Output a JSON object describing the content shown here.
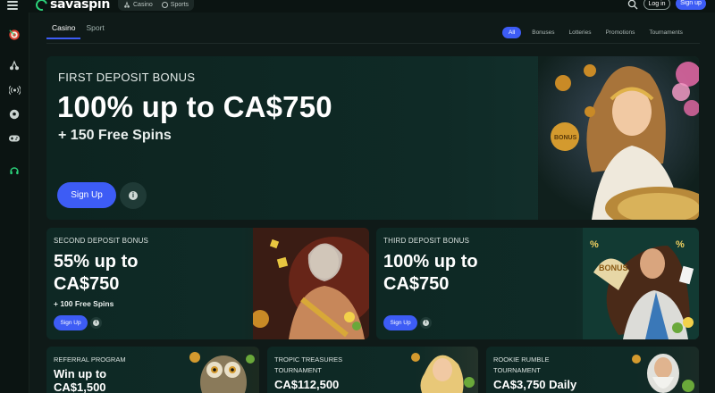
{
  "header": {
    "logo_text": "savaspin",
    "switch": [
      {
        "label": "Casino",
        "icon": "cherries-icon"
      },
      {
        "label": "Sports",
        "icon": "soccer-ball-icon"
      }
    ],
    "login_label": "Log in",
    "signup_label": "Sign up"
  },
  "sidebar": {
    "items": [
      {
        "icon": "dartboard-icon"
      },
      {
        "icon": "cherries-icon"
      },
      {
        "icon": "live-broadcast-icon"
      },
      {
        "icon": "soccer-ball-icon"
      },
      {
        "icon": "gamepad-icon"
      },
      {
        "icon": "headset-icon"
      }
    ]
  },
  "tabs": [
    {
      "label": "Casino",
      "active": true
    },
    {
      "label": "Sport",
      "active": false
    }
  ],
  "filters": [
    {
      "label": "All",
      "active": true
    },
    {
      "label": "Bonuses",
      "active": false
    },
    {
      "label": "Lotteries",
      "active": false
    },
    {
      "label": "Promotions",
      "active": false
    },
    {
      "label": "Tournaments",
      "active": false
    }
  ],
  "hero": {
    "kicker": "FIRST DEPOSIT BONUS",
    "title": "100% up to CA$750",
    "subtitle": "+ 150 Free Spins",
    "signup_label": "Sign Up",
    "art_text": "BONUS"
  },
  "cards": [
    {
      "kicker": "SECOND DEPOSIT BONUS",
      "title": "55% up to CA$750",
      "subtitle": "+ 100 Free Spins",
      "signup_label": "Sign Up"
    },
    {
      "kicker": "THIRD DEPOSIT BONUS",
      "title": "100% up to CA$750",
      "subtitle": "",
      "signup_label": "Sign Up",
      "art_text": "BONUS"
    }
  ],
  "small_cards": [
    {
      "kicker": "REFERRAL PROGRAM",
      "title": "Win up to CA$1,500"
    },
    {
      "kicker": "TROPIC TREASURES TOURNAMENT",
      "title": "CA$112,500"
    },
    {
      "kicker": "ROOKIE RUMBLE TOURNAMENT",
      "title": "CA$3,750 Daily"
    }
  ],
  "colors": {
    "accent": "#3d5cf5",
    "brand_green": "#2bd27a",
    "background": "#0f1a18",
    "card_bg": "#0f2a26"
  }
}
